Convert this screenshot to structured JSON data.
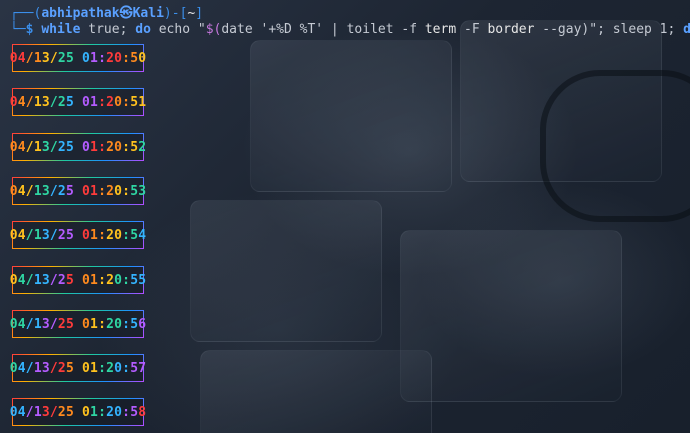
{
  "prompt": {
    "open": "┌──(",
    "user": "abhipathak",
    "at_symbol": "㉿",
    "host": "Kali",
    "mid": ")-[",
    "cwd": "~",
    "close": "]",
    "corner": "└─",
    "symbol": "$"
  },
  "command": {
    "kw_while": "while",
    "t1": " true; ",
    "kw_do": "do",
    "t2": " echo \"",
    "subst_open": "$(",
    "t3": "date '+%D %T' | toilet -f ",
    "term": "term",
    "t4": " -F ",
    "border": "border",
    "t5": " --gay)\"; sleep 1; ",
    "kw_done": "done"
  },
  "clock_outputs": [
    {
      "date": "04/13/25",
      "time": "01:20:50"
    },
    {
      "date": "04/13/25",
      "time": "01:20:51"
    },
    {
      "date": "04/13/25",
      "time": "01:20:52"
    },
    {
      "date": "04/13/25",
      "time": "01:20:53"
    },
    {
      "date": "04/13/25",
      "time": "01:20:54"
    },
    {
      "date": "04/13/25",
      "time": "01:20:55"
    },
    {
      "date": "04/13/25",
      "time": "01:20:56"
    },
    {
      "date": "04/13/25",
      "time": "01:20:57"
    },
    {
      "date": "04/13/25",
      "time": "01:20:58"
    }
  ],
  "rainbow_colors": [
    "#ff3b3b",
    "#ff8a1e",
    "#ffc21e",
    "#2fd6a3",
    "#34b4ff",
    "#b45cff"
  ]
}
